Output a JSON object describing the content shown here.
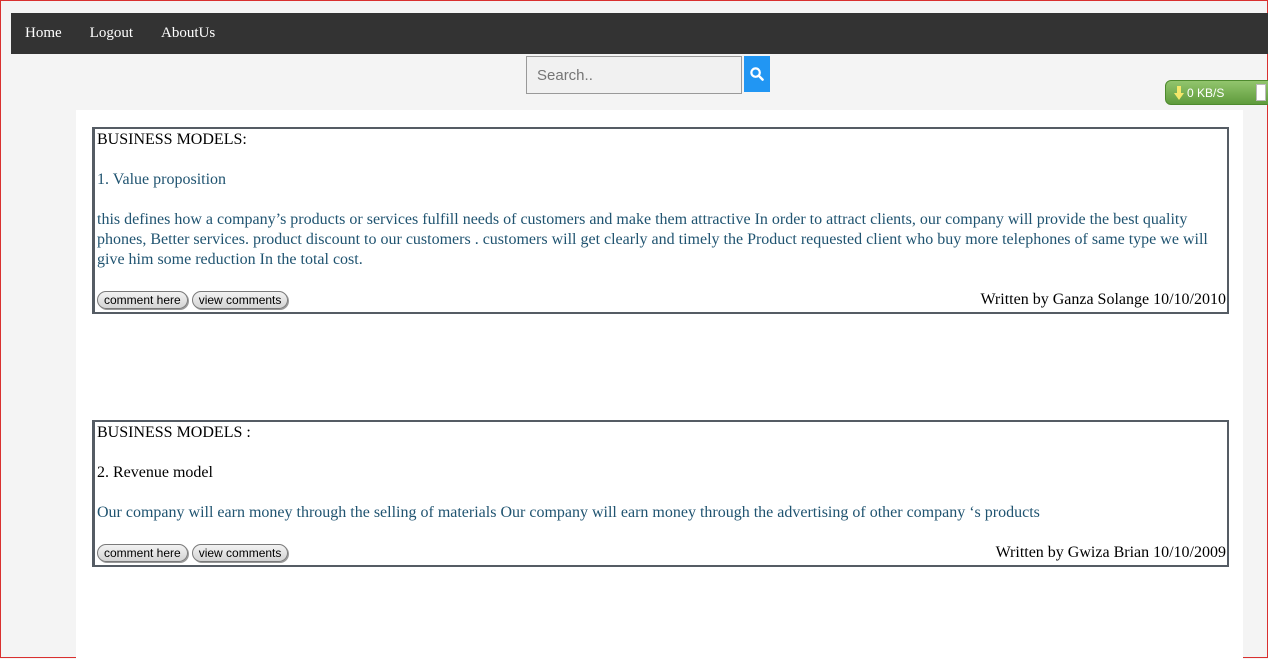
{
  "nav": {
    "items": [
      {
        "label": "Home"
      },
      {
        "label": "Logout"
      },
      {
        "label": "AboutUs"
      }
    ]
  },
  "search": {
    "placeholder": "Search..",
    "button_icon": "search-icon"
  },
  "speed_widget": {
    "label": "0 KB/S"
  },
  "posts": [
    {
      "heading": "BUSINESS MODELS:",
      "subtitle": "1. Value proposition",
      "body": "this defines how a company’s products or services fulfill needs of customers and make them attractive In order to attract clients, our company will provide the best quality phones, Better services. product discount to our customers . customers will get clearly and timely the Product requested client who buy more telephones of same type we will give him some reduction In the total cost.",
      "comment_label": "comment here",
      "view_label": "view comments",
      "byline": "Written by Ganza Solange 10/10/2010"
    },
    {
      "heading": "BUSINESS MODELS :",
      "subtitle": "2. Revenue model",
      "body": "Our company will earn money through the selling of materials Our company will earn money through the advertising of other company ‘s products",
      "comment_label": "comment here",
      "view_label": "view comments",
      "byline": "Written by Gwiza Brian 10/10/2009"
    }
  ],
  "colors": {
    "navbar": "#333333",
    "accent": "#2196f3",
    "post_text": "#1f5370",
    "subtitle_post1": "#1f5370",
    "subtitle_post2": "#000000"
  }
}
